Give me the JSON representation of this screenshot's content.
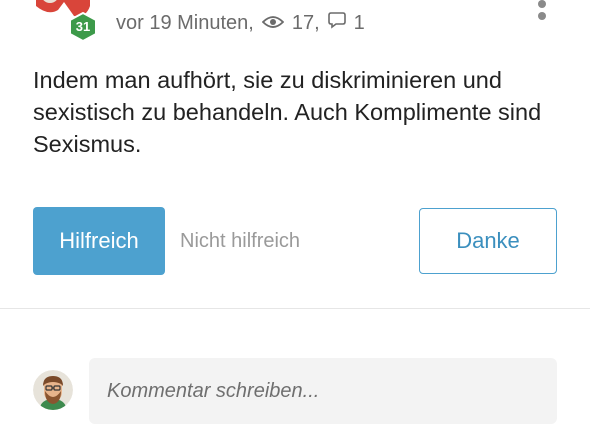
{
  "header": {
    "level_badge": "31",
    "time": "vor 19 Minuten,",
    "views": "17,",
    "comments": "1",
    "icons": {
      "avatar": "user-avatar-icon",
      "views": "eye-icon",
      "comments": "comment-bubble-icon",
      "menu": "more-vertical-icon"
    }
  },
  "answer": {
    "text": "Indem man aufhört, sie zu diskriminieren und sexistisch zu behandeln. Auch Komplimente sind Sexismus."
  },
  "actions": {
    "helpful_label": "Hilfreich",
    "unhelpful_label": "Nicht hilfreich",
    "thanks_label": "Danke"
  },
  "comment": {
    "placeholder": "Kommentar schreiben..."
  },
  "colors": {
    "accent": "#4da1cf",
    "badge_green": "#3d9a4a",
    "avatar_red": "#d9453a"
  }
}
